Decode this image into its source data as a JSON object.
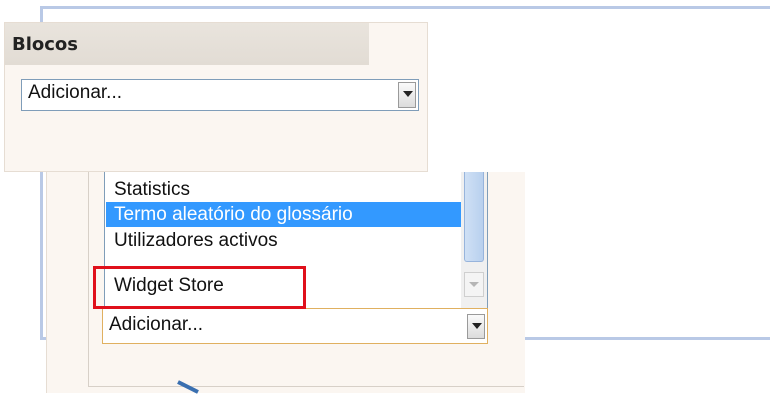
{
  "blocks": {
    "title": "Blocos",
    "select_value": "Adicionar..."
  },
  "dropdown": {
    "items": [
      {
        "label": "Statistics",
        "selected": false
      },
      {
        "label": "Termo aleatório do glossário",
        "selected": true
      },
      {
        "label": "Utilizadores activos",
        "selected": false
      },
      {
        "label": "Widget Store",
        "selected": false
      }
    ],
    "select_value": "Adicionar..."
  },
  "colors": {
    "selection": "#3399ff",
    "highlight": "#e0101b",
    "frame": "#b9c9e6",
    "panel_bg": "#fbf6f1"
  }
}
